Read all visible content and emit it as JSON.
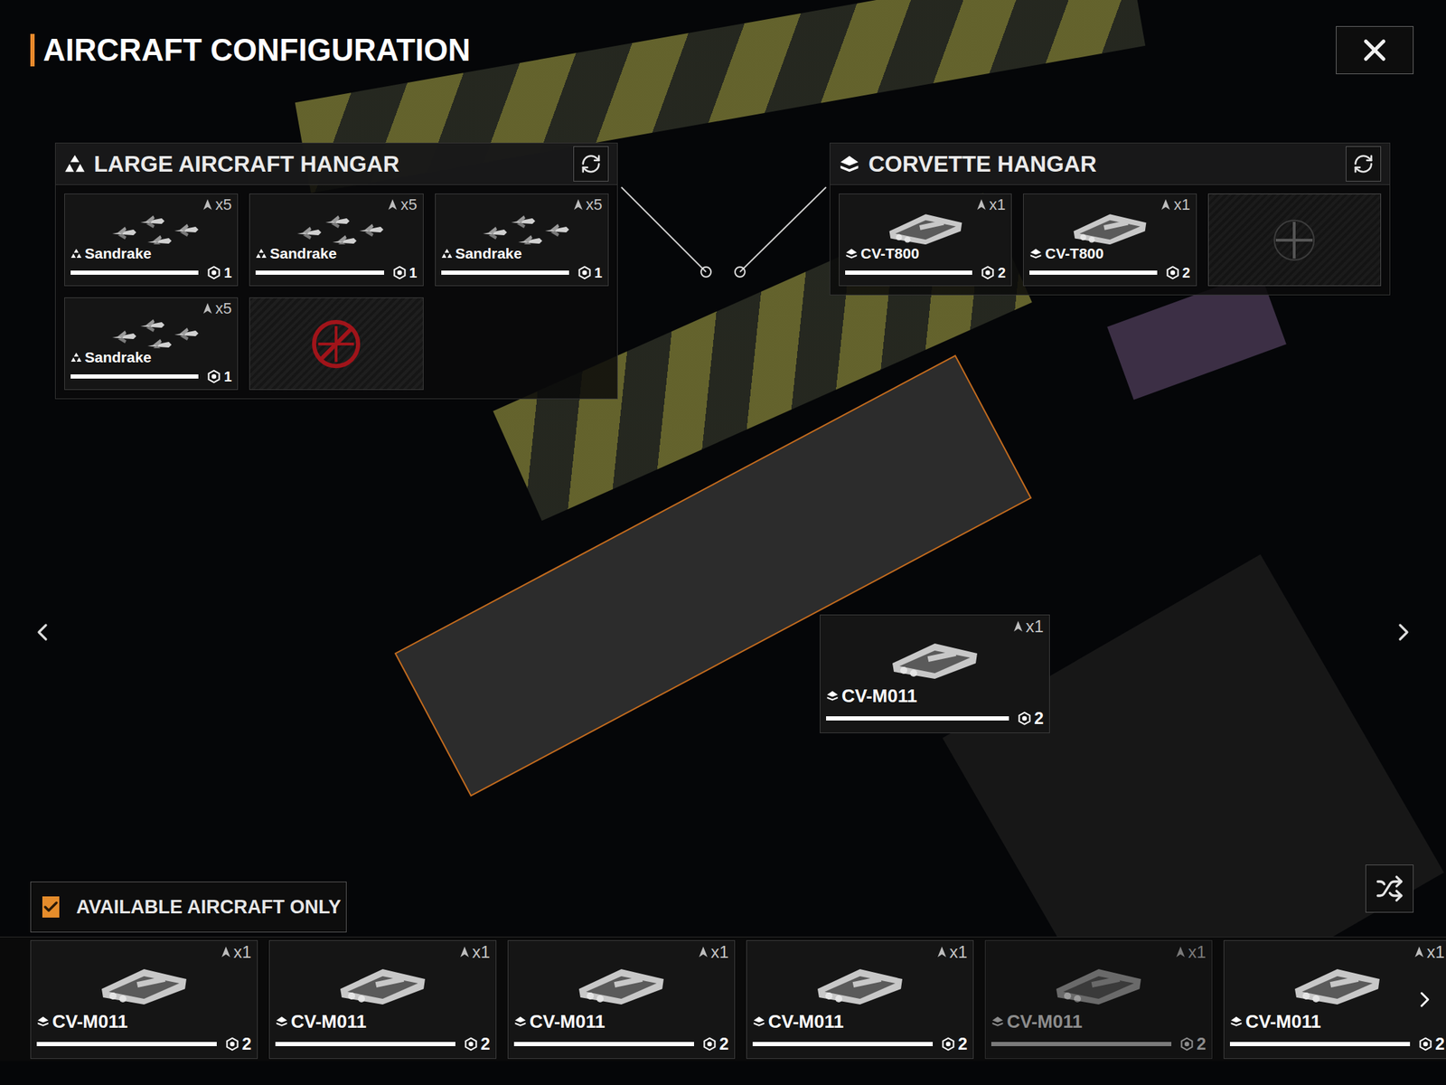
{
  "title": "AIRCRAFT CONFIGURATION",
  "large_hangar": {
    "title": "LARGE AIRCRAFT HANGAR",
    "slots": [
      {
        "kind": "aircraft",
        "name": "Sandrake",
        "squadron": "x5",
        "cost": "1",
        "level": 1
      },
      {
        "kind": "aircraft",
        "name": "Sandrake",
        "squadron": "x5",
        "cost": "1",
        "level": 1
      },
      {
        "kind": "aircraft",
        "name": "Sandrake",
        "squadron": "x5",
        "cost": "1",
        "level": 1
      },
      {
        "kind": "aircraft",
        "name": "Sandrake",
        "squadron": "x5",
        "cost": "1",
        "level": 1
      },
      {
        "kind": "locked"
      }
    ]
  },
  "corvette_hangar": {
    "title": "CORVETTE HANGAR",
    "slots": [
      {
        "kind": "aircraft",
        "name": "CV-T800",
        "squadron": "x1",
        "cost": "2",
        "level": 1
      },
      {
        "kind": "aircraft",
        "name": "CV-T800",
        "squadron": "x1",
        "cost": "2",
        "level": 1
      },
      {
        "kind": "empty"
      }
    ]
  },
  "dragged": {
    "name": "CV-M011",
    "squadron": "x1",
    "cost": "2",
    "level": 1
  },
  "filter": {
    "label": "AVAILABLE AIRCRAFT ONLY",
    "checked": true
  },
  "inventory": [
    {
      "name": "CV-M011",
      "squadron": "x1",
      "cost": "2",
      "level": 1,
      "disabled": false
    },
    {
      "name": "CV-M011",
      "squadron": "x1",
      "cost": "2",
      "level": 1,
      "disabled": false
    },
    {
      "name": "CV-M011",
      "squadron": "x1",
      "cost": "2",
      "level": 1,
      "disabled": false
    },
    {
      "name": "CV-M011",
      "squadron": "x1",
      "cost": "2",
      "level": 1,
      "disabled": false
    },
    {
      "name": "CV-M011",
      "squadron": "x1",
      "cost": "2",
      "level": 1,
      "disabled": true
    },
    {
      "name": "CV-M011",
      "squadron": "x1",
      "cost": "2",
      "level": 1,
      "disabled": false
    }
  ]
}
